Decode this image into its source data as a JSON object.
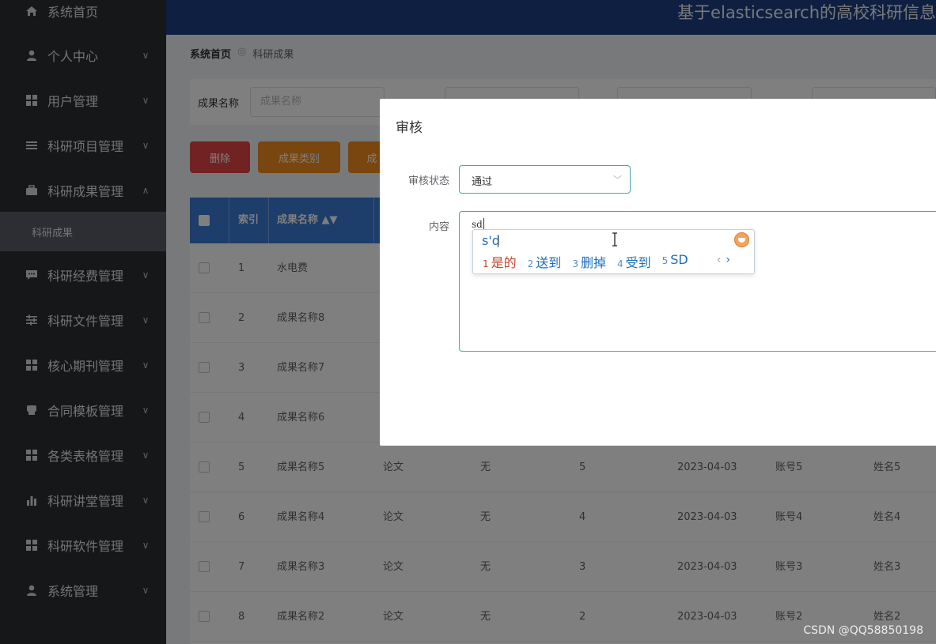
{
  "sidebar": {
    "items": [
      {
        "label": "系统首页",
        "icon": "home-icon",
        "chevron": ""
      },
      {
        "label": "个人中心",
        "icon": "user-icon",
        "chevron": "∨"
      },
      {
        "label": "用户管理",
        "icon": "grid-icon",
        "chevron": "∨"
      },
      {
        "label": "科研项目管理",
        "icon": "list-icon",
        "chevron": "∨"
      },
      {
        "label": "科研成果管理",
        "icon": "briefcase-icon",
        "chevron": "∧"
      },
      {
        "label": "科研经费管理",
        "icon": "chat-icon",
        "chevron": "∨"
      },
      {
        "label": "科研文件管理",
        "icon": "sliders-icon",
        "chevron": "∨"
      },
      {
        "label": "核心期刊管理",
        "icon": "grid-icon",
        "chevron": "∨"
      },
      {
        "label": "合同模板管理",
        "icon": "printer-icon",
        "chevron": "∨"
      },
      {
        "label": "各类表格管理",
        "icon": "grid-icon",
        "chevron": "∨"
      },
      {
        "label": "科研讲堂管理",
        "icon": "bar-chart-icon",
        "chevron": "∨"
      },
      {
        "label": "科研软件管理",
        "icon": "grid-icon",
        "chevron": "∨"
      },
      {
        "label": "系统管理",
        "icon": "person-icon",
        "chevron": "∨"
      }
    ],
    "active_sub": "科研成果"
  },
  "header": {
    "title": "基于elasticsearch的高校科研信息"
  },
  "breadcrumb": {
    "home": "系统首页",
    "separator": "◎",
    "current": "科研成果"
  },
  "search": {
    "label": "成果名称",
    "placeholder": "成果名称"
  },
  "actions": {
    "delete": "删除",
    "category": "成果类别",
    "more": "成"
  },
  "table": {
    "headers": {
      "index": "索引",
      "name": "成果名称 ▲▼"
    },
    "rows": [
      {
        "index": "1",
        "name": "水电费",
        "type": "",
        "attach": "",
        "count": "",
        "date": "",
        "account": "",
        "person": ""
      },
      {
        "index": "2",
        "name": "成果名称8",
        "type": "",
        "attach": "",
        "count": "",
        "date": "",
        "account": "",
        "person": ""
      },
      {
        "index": "3",
        "name": "成果名称7",
        "type": "",
        "attach": "",
        "count": "",
        "date": "",
        "account": "",
        "person": ""
      },
      {
        "index": "4",
        "name": "成果名称6",
        "type": "",
        "attach": "",
        "count": "",
        "date": "",
        "account": "",
        "person": ""
      },
      {
        "index": "5",
        "name": "成果名称5",
        "type": "论文",
        "attach": "无",
        "count": "5",
        "date": "2023-04-03",
        "account": "账号5",
        "person": "姓名5"
      },
      {
        "index": "6",
        "name": "成果名称4",
        "type": "论文",
        "attach": "无",
        "count": "4",
        "date": "2023-04-03",
        "account": "账号4",
        "person": "姓名4"
      },
      {
        "index": "7",
        "name": "成果名称3",
        "type": "论文",
        "attach": "无",
        "count": "3",
        "date": "2023-04-03",
        "account": "账号3",
        "person": "姓名3"
      },
      {
        "index": "8",
        "name": "成果名称2",
        "type": "论文",
        "attach": "无",
        "count": "2",
        "date": "2023-04-03",
        "account": "账号2",
        "person": "姓名2"
      }
    ]
  },
  "dialog": {
    "title": "审核",
    "status_label": "审核状态",
    "status_value": "通过",
    "content_label": "内容",
    "content_value": "sd"
  },
  "ime": {
    "composition": "s'd",
    "candidates": [
      {
        "num": "1",
        "text": "是的"
      },
      {
        "num": "2",
        "text": "送到"
      },
      {
        "num": "3",
        "text": "删掉"
      },
      {
        "num": "4",
        "text": "受到"
      },
      {
        "num": "5",
        "text": "SD"
      }
    ],
    "prev": "‹",
    "next": "›"
  },
  "watermark": "CSDN @QQ58850198",
  "colors": {
    "sidebar": "#2c2e31",
    "header": "#1d3e82",
    "table_header": "#3a7bd5",
    "delete": "#e54545",
    "warning": "#f08c1c",
    "focus": "#4aa3b3"
  }
}
